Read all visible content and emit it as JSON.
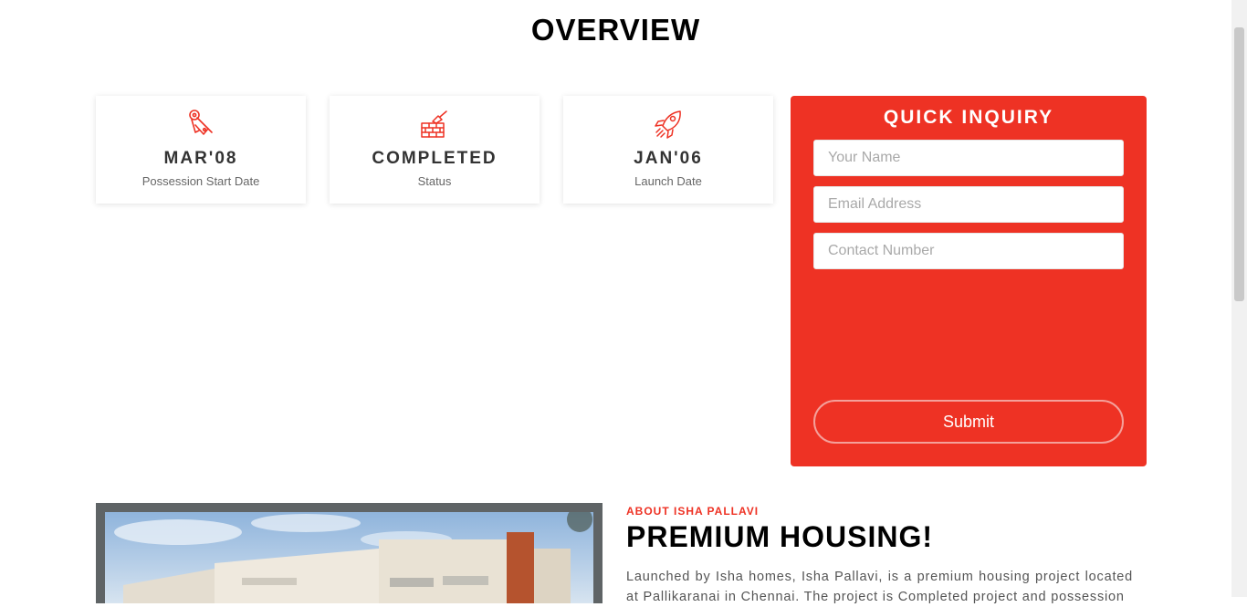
{
  "overview": {
    "title": "OVERVIEW",
    "cards": [
      {
        "icon": "key-tag-icon",
        "value": "MAR'08",
        "label": "Possession Start Date"
      },
      {
        "icon": "brick-wall-trowel-icon",
        "value": "COMPLETED",
        "label": "Status"
      },
      {
        "icon": "rocket-icon",
        "value": "JAN'06",
        "label": "Launch Date"
      }
    ]
  },
  "inquiry": {
    "title": "QUICK INQUIRY",
    "name_placeholder": "Your Name",
    "email_placeholder": "Email Address",
    "contact_placeholder": "Contact Number",
    "submit_label": "Submit"
  },
  "about": {
    "eyebrow": "ABOUT ISHA PALLAVI",
    "heading": "PREMIUM HOUSING!",
    "text": "Launched by Isha homes, Isha Pallavi, is a premium housing project located at Pallikaranai in Chennai. The project is Completed project and possession"
  },
  "colors": {
    "accent": "#ee3224",
    "text_dark": "#333333",
    "frame": "#5f6466"
  }
}
